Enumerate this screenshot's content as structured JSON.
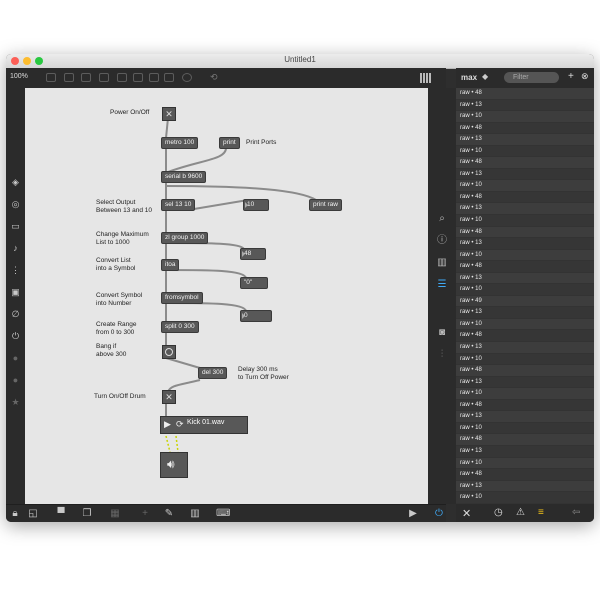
{
  "window": {
    "title": "Untitled1"
  },
  "toolbar": {
    "zoom": "100%"
  },
  "console": {
    "title": "max",
    "filter_placeholder": "Filter",
    "rows": [
      "raw • 48",
      "raw • 13",
      "raw • 10",
      "raw • 48",
      "raw • 13",
      "raw • 10",
      "raw • 48",
      "raw • 13",
      "raw • 10",
      "raw • 48",
      "raw • 13",
      "raw • 10",
      "raw • 48",
      "raw • 13",
      "raw • 10",
      "raw • 48",
      "raw • 13",
      "raw • 10",
      "raw • 49",
      "raw • 13",
      "raw • 10",
      "raw • 48",
      "raw • 13",
      "raw • 10",
      "raw • 48",
      "raw • 13",
      "raw • 10",
      "raw • 48",
      "raw • 13",
      "raw • 10",
      "raw • 48",
      "raw • 13",
      "raw • 10",
      "raw • 48",
      "raw • 13",
      "raw • 10"
    ]
  },
  "patch": {
    "comments": {
      "power": "Power On/Off",
      "print_ports": "Print Ports",
      "select_output": "Select Output\nBetween 13 and 10",
      "change_max": "Change Maximum\nList to 1000",
      "convert_list": "Convert List\ninto a Symbol",
      "convert_symbol": "Convert Symbol\ninto Number",
      "create_range": "Create Range\nfrom 0 to 300",
      "bang_if": "Bang if\nabove 300",
      "delay": "Delay 300 ms\nto Turn Off Power",
      "drum": "Turn On/Off Drum"
    },
    "objects": {
      "metro": "metro 100",
      "print": "print",
      "serial": "serial b 9600",
      "sel": "sel 13 10",
      "num10": "10",
      "print_raw": "print raw",
      "zl": "zl group 1000",
      "num48": "48",
      "itoa": "itoa",
      "msg0": "\"0\"",
      "fromsymbol": "fromsymbol",
      "num0": "0",
      "split": "split 0 300",
      "del": "del 300",
      "sfplay_file": "Kick 01.wav"
    }
  }
}
